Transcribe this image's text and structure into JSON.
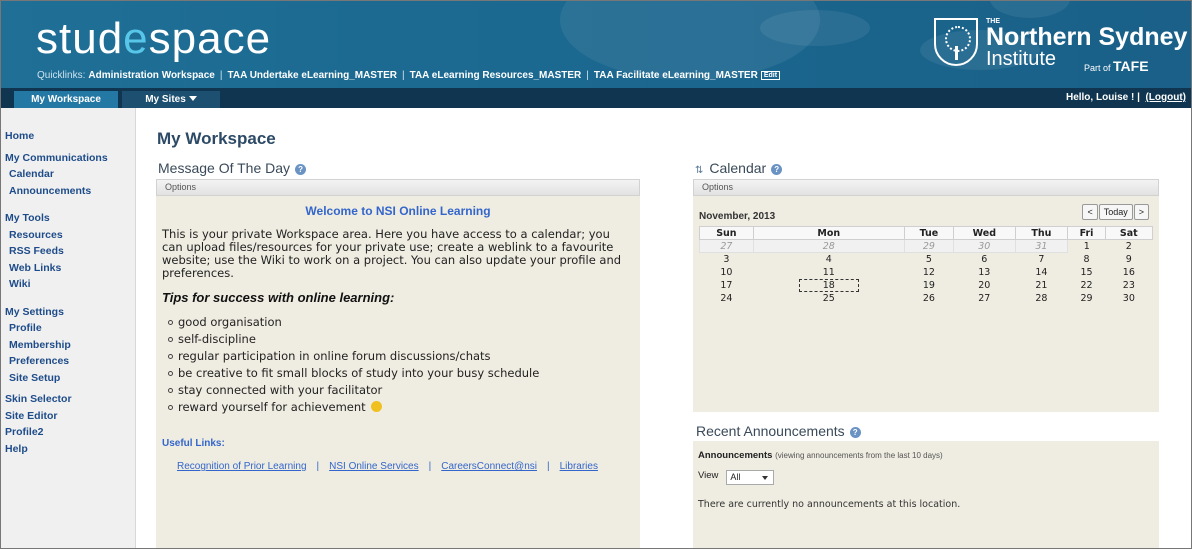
{
  "banner": {
    "logo_main_a": "stud",
    "logo_accent": "e",
    "logo_main_b": "space",
    "quicklinks_label": "Quicklinks:",
    "quicklinks": [
      "Administration Workspace",
      "TAA Undertake eLearning_MASTER",
      "TAA eLearning Resources_MASTER",
      "TAA Facilitate eLearning_MASTER"
    ],
    "edit_label": "Edit",
    "institute_the": "THE",
    "institute_name": "Northern Sydney",
    "institute_sub": "Institute",
    "institute_part": "Part of",
    "institute_tafe": "TAFE"
  },
  "nav": {
    "workspace_tab": "My Workspace",
    "sites_tab": "My Sites",
    "greeting": "Hello, Louise ! |",
    "logout": "(Logout)"
  },
  "sidebar": {
    "home": "Home",
    "communications": "My Communications",
    "calendar": "Calendar",
    "announcements": "Announcements",
    "tools": "My Tools",
    "resources": "Resources",
    "rss": "RSS Feeds",
    "weblinks": "Web Links",
    "wiki": "Wiki",
    "settings": "My Settings",
    "profile": "Profile",
    "membership": "Membership",
    "preferences": "Preferences",
    "site_setup": "Site Setup",
    "skin_selector": "Skin Selector",
    "site_editor": "Site Editor",
    "profile2": "Profile2",
    "help": "Help"
  },
  "main": {
    "page_title": "My Workspace",
    "motd_title": "Message Of The Day",
    "options_label": "Options",
    "motd_heading": "Welcome to NSI Online Learning",
    "motd_body": "This is your private Workspace area. Here you have access to a calendar; you can upload files/resources for your private use; create a weblink to a favourite website; use the Wiki to work on a project. You can also update your profile and preferences.",
    "tips_heading": "Tips for success with online learning:",
    "tips": [
      "good organisation",
      "self-discipline",
      "regular participation in online forum discussions/chats",
      "be creative to fit small blocks of study into your busy schedule",
      "stay connected with your facilitator",
      "reward yourself for achievement"
    ],
    "useful_heading": "Useful Links:",
    "useful_links": [
      "Recognition of Prior Learning",
      "NSI Online Services",
      "CareersConnect@nsi",
      "Libraries"
    ]
  },
  "calendar": {
    "title": "Calendar",
    "month": "November, 2013",
    "prev": "<",
    "today": "Today",
    "next": ">",
    "weekdays": [
      "Sun",
      "Mon",
      "Tue",
      "Wed",
      "Thu",
      "Fri",
      "Sat"
    ],
    "prev_days": [
      "27",
      "28",
      "29",
      "30",
      "31"
    ],
    "week1_days": [
      "1",
      "2"
    ],
    "weeks": [
      [
        "3",
        "4",
        "5",
        "6",
        "7",
        "8",
        "9"
      ],
      [
        "10",
        "11",
        "12",
        "13",
        "14",
        "15",
        "16"
      ],
      [
        "17",
        "18",
        "19",
        "20",
        "21",
        "22",
        "23"
      ],
      [
        "24",
        "25",
        "26",
        "27",
        "28",
        "29",
        "30"
      ]
    ]
  },
  "announcements": {
    "title": "Recent Announcements",
    "label": "Announcements",
    "sub": "(viewing announcements from the last 10 days)",
    "view_label": "View",
    "view_value": "All",
    "empty": "There are currently no announcements at this location."
  },
  "colors": {
    "banner": "#1f6f96",
    "navbar": "#0f3550",
    "active_tab": "#2478a4",
    "link": "#3366cc",
    "panel": "#efece1"
  }
}
